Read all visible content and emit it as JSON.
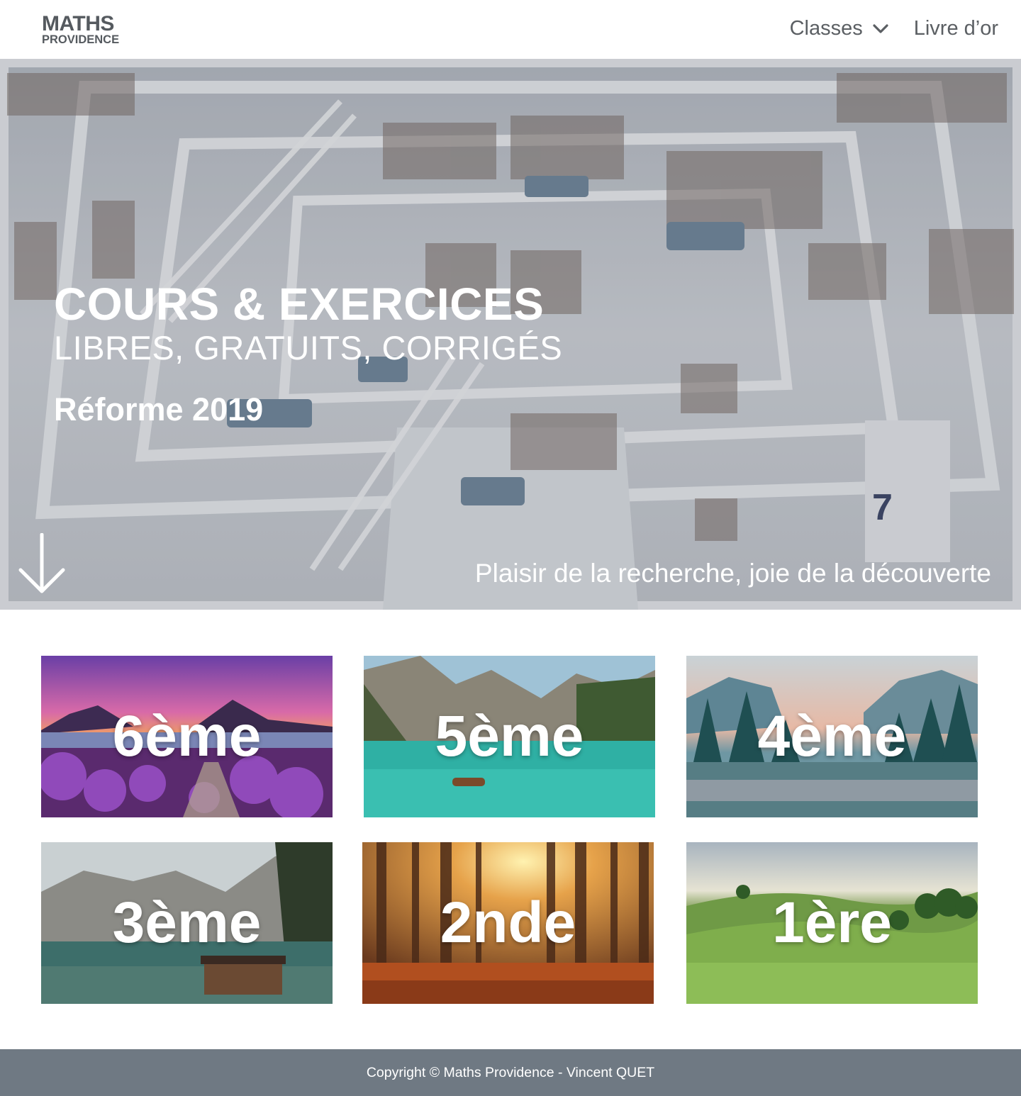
{
  "header": {
    "logo": {
      "line1": "MATHS",
      "line2": "PROVIDENCE"
    },
    "nav": {
      "classes_label": "Classes",
      "guestbook_label": "Livre d’or"
    }
  },
  "hero": {
    "title": "COURS & EXERCICES",
    "subtitle": "LIBRES, GRATUITS, CORRIGÉS",
    "reform": "Réforme 2019",
    "tagline": "Plaisir de la recherche, joie de la découverte"
  },
  "cards": [
    {
      "label": "6ème"
    },
    {
      "label": "5ème"
    },
    {
      "label": "4ème"
    },
    {
      "label": "3ème"
    },
    {
      "label": "2nde"
    },
    {
      "label": "1ère"
    }
  ],
  "footer": {
    "copyright": "Copyright © Maths Providence - Vincent QUET"
  },
  "colors": {
    "logo": "#555a5f",
    "nav_text": "#5b5f63",
    "footer_bg": "#6f7983",
    "hero_text": "#ffffff"
  },
  "icons": {
    "nav_dropdown": "chevron-down-icon",
    "scroll": "arrow-down-icon"
  }
}
